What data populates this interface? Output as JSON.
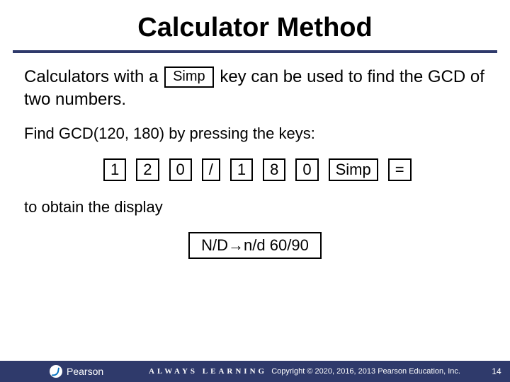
{
  "title": "Calculator Method",
  "intro": {
    "before_key": "Calculators with a ",
    "key_label": "Simp",
    "after_key": " key can be used to find the GCD of two numbers."
  },
  "instruction": "Find GCD(120, 180) by pressing the keys:",
  "keys": [
    "1",
    "2",
    "0",
    "/",
    "1",
    "8",
    "0",
    "Simp",
    "="
  ],
  "obtain_text": "to obtain the display",
  "display_result": "N/D→n/d 60/90",
  "footer": {
    "brand": "Pearson",
    "tagline": "ALWAYS LEARNING",
    "copyright": "Copyright © 2020, 2016, 2013 Pearson Education, Inc.",
    "page": "14"
  }
}
